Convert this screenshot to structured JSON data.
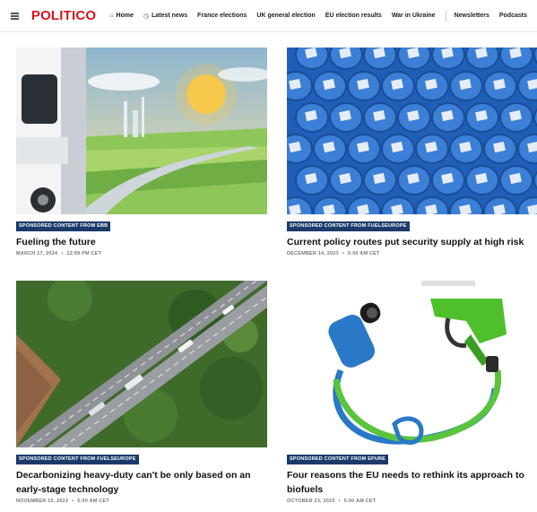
{
  "header": {
    "logo": "POLITICO",
    "nav": [
      {
        "label": "Home",
        "icon": "⌂"
      },
      {
        "label": "Latest news",
        "icon": "◷"
      },
      {
        "label": "France elections",
        "icon": ""
      },
      {
        "label": "UK general election",
        "icon": ""
      },
      {
        "label": "EU election results",
        "icon": ""
      },
      {
        "label": "War in Ukraine",
        "icon": ""
      },
      {
        "label": "Newsletters",
        "icon": ""
      },
      {
        "label": "Podcasts",
        "icon": ""
      }
    ]
  },
  "articles": [
    {
      "badge": "SPONSORED CONTENT FROM EBB",
      "title": "Fueling the future",
      "date": "MARCH 17, 2024",
      "time": "12:59 PM CET"
    },
    {
      "badge": "SPONSORED CONTENT FROM FUELSEUROPE",
      "title": "Current policy routes put security supply at high risk",
      "date": "DECEMBER 14, 2023",
      "time": "5:00 AM CET"
    },
    {
      "badge": "SPONSORED CONTENT FROM FUELSEUROPE",
      "title": "Decarbonizing heavy-duty can't be only based on an early-stage technology",
      "date": "NOVEMBER 15, 2023",
      "time": "5:00 AM CET"
    },
    {
      "badge": "SPONSORED CONTENT FROM EPURE",
      "title": "Four reasons the EU needs to rethink its approach to biofuels",
      "date": "OCTOBER 23, 2023",
      "time": "5:00 AM CET"
    }
  ],
  "colors": {
    "brand": "#d4141c",
    "badge": "#1b3a6b"
  }
}
